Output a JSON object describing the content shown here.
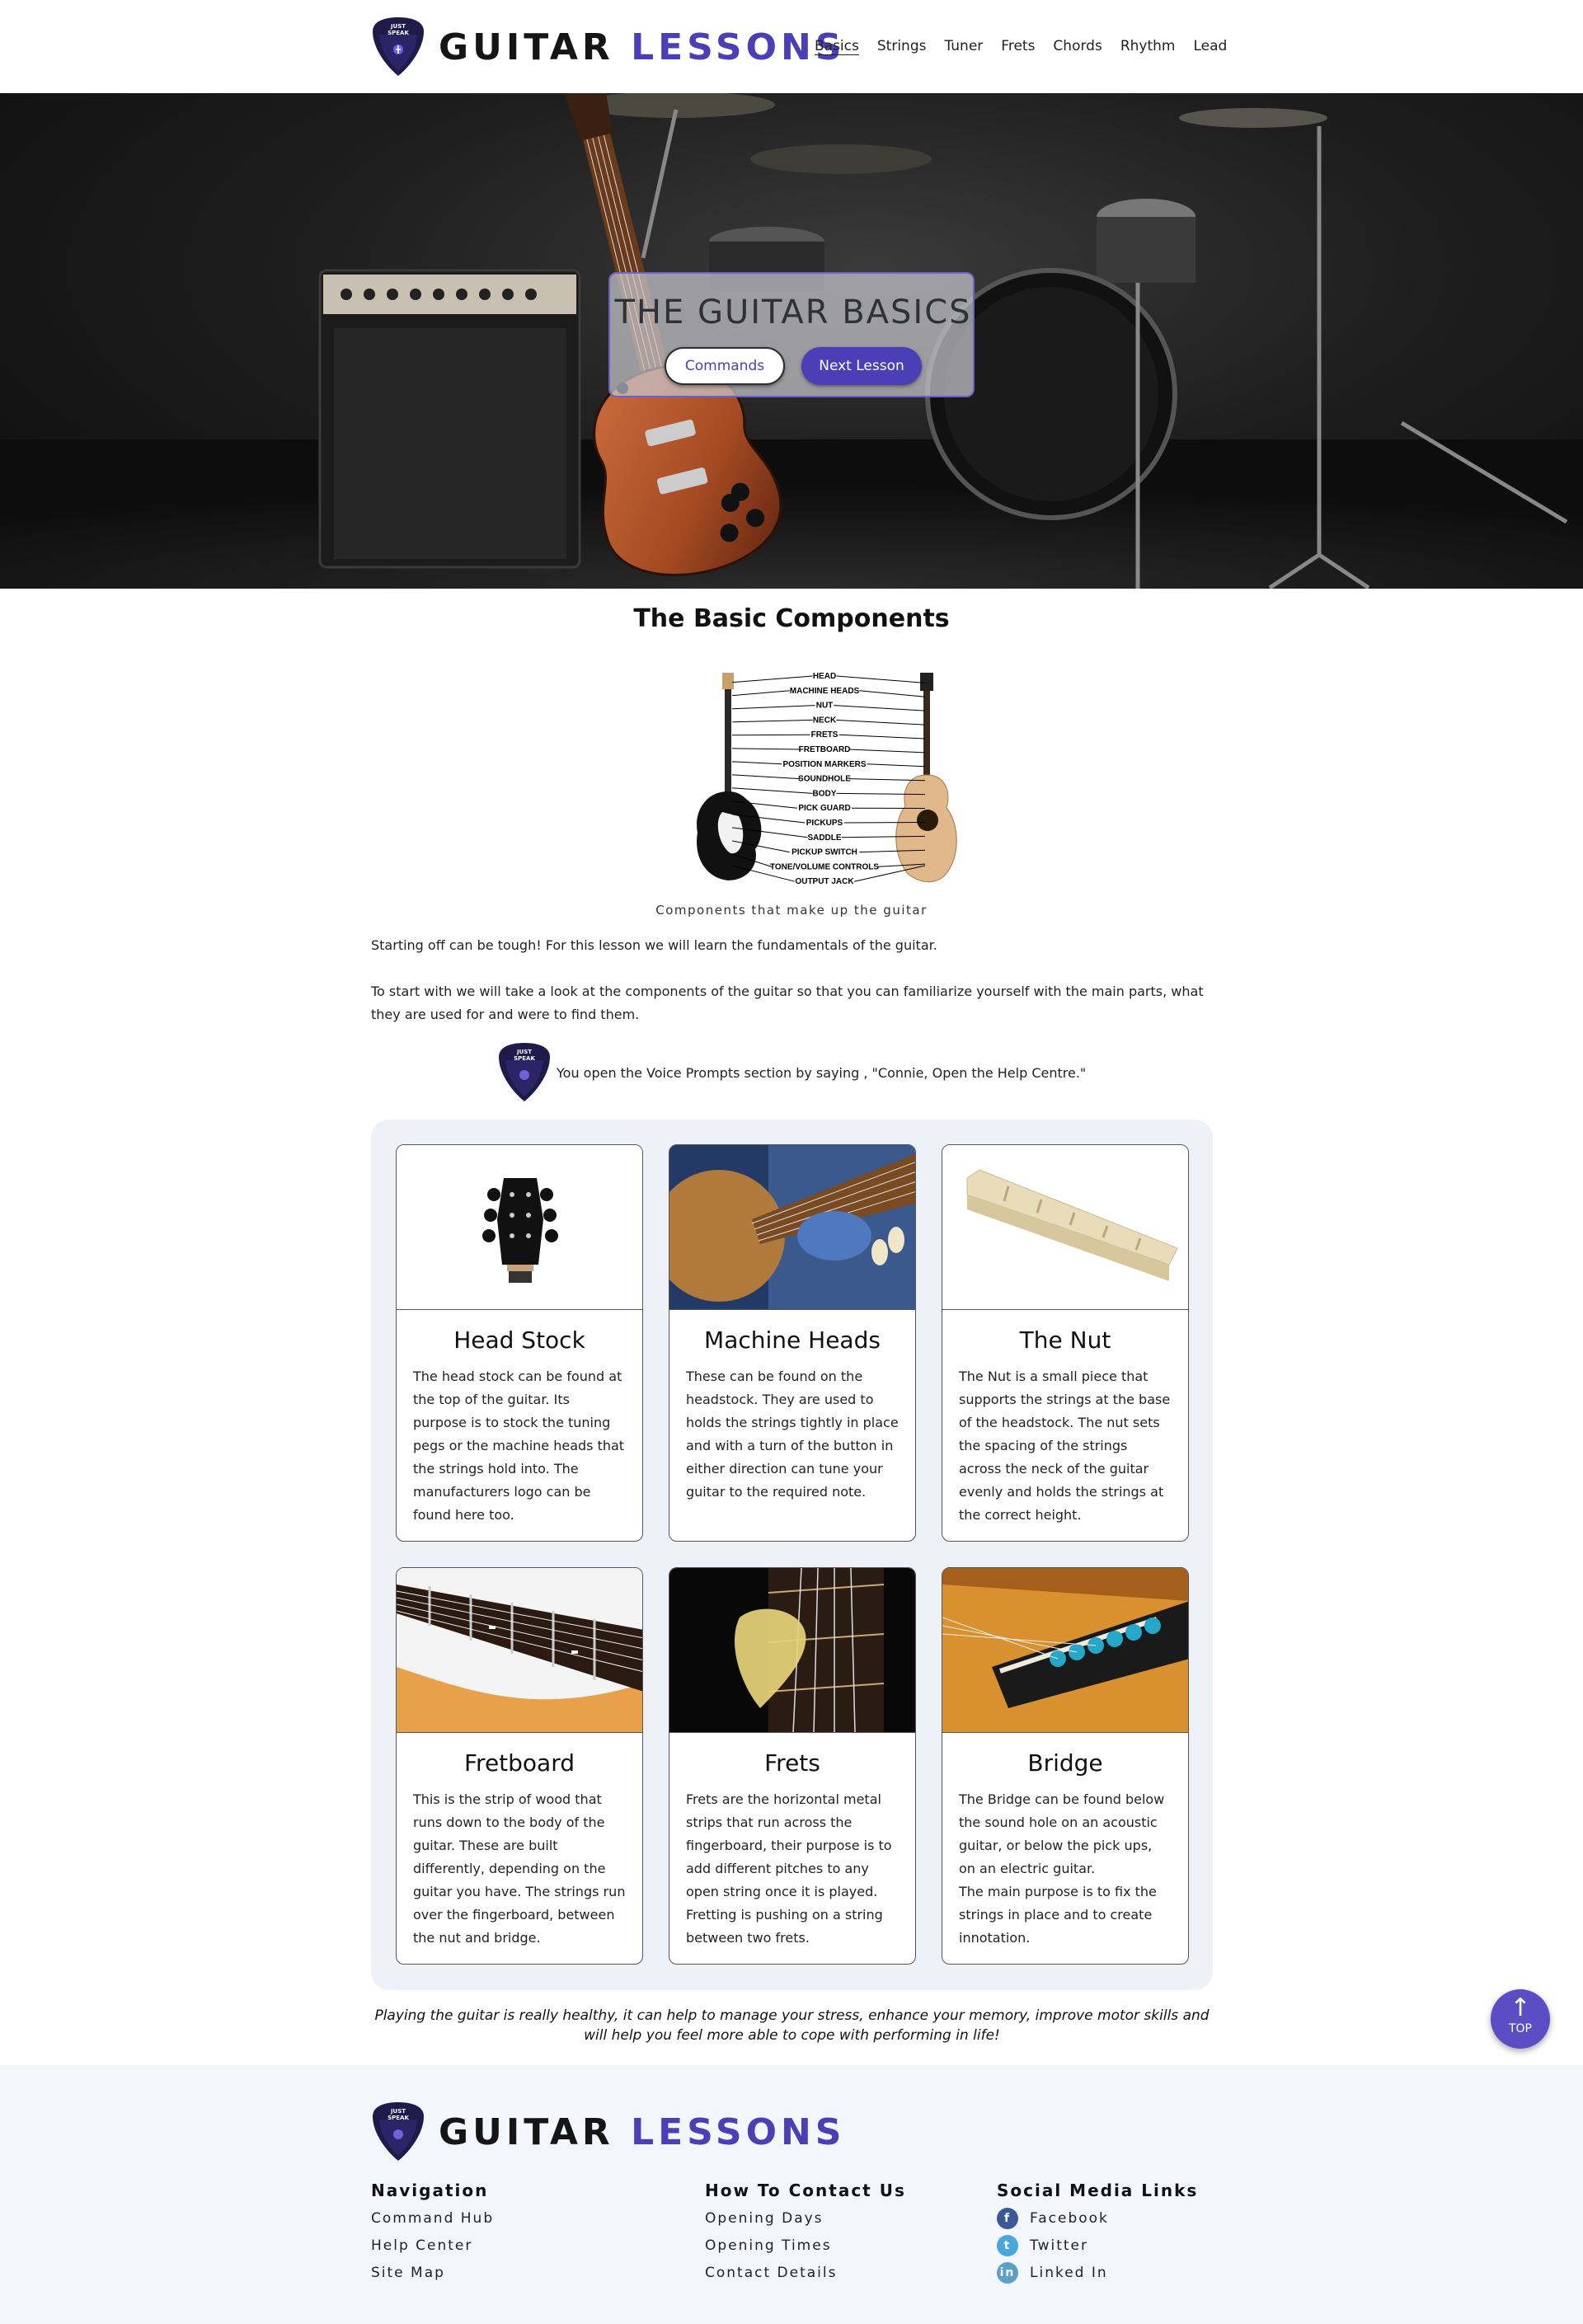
{
  "header": {
    "logo_text": "JUST SPEAK",
    "brand_part1": "GUITAR",
    "brand_part2": "LESSONS",
    "nav": [
      "Basics",
      "Strings",
      "Tuner",
      "Frets",
      "Chords",
      "Rhythm",
      "Lead"
    ],
    "active_nav": "Basics"
  },
  "hero": {
    "title": "THE GUITAR BASICS",
    "commands_label": "Commands",
    "next_label": "Next Lesson"
  },
  "main": {
    "section_title": "The Basic Components",
    "diagram_labels": [
      "HEAD",
      "MACHINE HEADS",
      "NUT",
      "NECK",
      "FRETS",
      "FRETBOARD",
      "POSITION MARKERS",
      "SOUNDHOLE",
      "BODY",
      "PICK GUARD",
      "PICKUPS",
      "SADDLE",
      "PICKUP SWITCH",
      "TONE/VOLUME CONTROLS",
      "OUTPUT JACK"
    ],
    "caption": "Components that make up the guitar",
    "paragraph1": "Starting off can be tough! For this lesson we will learn the fundamentals of the guitar.",
    "paragraph2": "To start with we will take a look at the components of the guitar so that you can familiarize yourself with the main parts, what they are used for and were to find them.",
    "voice_prompt": "You open the Voice Prompts section by saying , \"Connie, Open the Help Centre.\""
  },
  "cards": [
    {
      "title": "Head Stock",
      "text": "The head stock can be found at the top of the guitar. Its purpose is to stock the tuning pegs or the machine heads that the strings hold into. The manufacturers logo can be found here too."
    },
    {
      "title": "Machine Heads",
      "text": "These can be found on the headstock. They are used to holds the strings tightly in place and with a turn of the button in either direction can tune your guitar to the required note."
    },
    {
      "title": "The Nut",
      "text": "The Nut is a small piece that supports the strings at the base of the headstock. The nut sets the spacing of the strings across the neck of the guitar evenly and holds the strings at the correct height."
    },
    {
      "title": "Fretboard",
      "text": "This is the strip of wood that runs down to the body of the guitar. These are built differently, depending on the guitar you have. The strings run over the fingerboard, between the nut and bridge."
    },
    {
      "title": "Frets",
      "text": "Frets are the horizontal metal strips that run across the fingerboard, their purpose is to add different pitches to any open string once it is played. Fretting is pushing on a string between two frets."
    },
    {
      "title": "Bridge",
      "text": "The Bridge can be found below the sound hole on an acoustic guitar, or below the pick ups, on an electric guitar.\nThe main purpose is to fix the strings in place and to create innotation."
    }
  ],
  "quote": "Playing the guitar is really healthy, it can help to manage your stress, enhance your memory, improve motor skills and will help you feel more able to cope with performing in life!",
  "top_button": "TOP",
  "footer": {
    "brand_part1": "GUITAR",
    "brand_part2": "LESSONS",
    "navigation": {
      "heading": "Navigation",
      "links": [
        "Command Hub",
        "Help Center",
        "Site Map"
      ]
    },
    "contact": {
      "heading": "How To Contact Us",
      "links": [
        "Opening Days",
        "Opening Times",
        "Contact Details"
      ]
    },
    "social": {
      "heading": "Social Media Links",
      "links": [
        {
          "label": "Facebook",
          "icon": "facebook-icon",
          "color": "#3b5998"
        },
        {
          "label": "Twitter",
          "icon": "twitter-icon",
          "color": "#4aa6dc"
        },
        {
          "label": "Linked In",
          "icon": "linkedin-icon",
          "color": "#5aa0c7"
        }
      ]
    }
  },
  "colors": {
    "brand": "#4b3fb8",
    "footer_bg": "#f3f6fb",
    "panel_bg": "#eef2f8"
  }
}
